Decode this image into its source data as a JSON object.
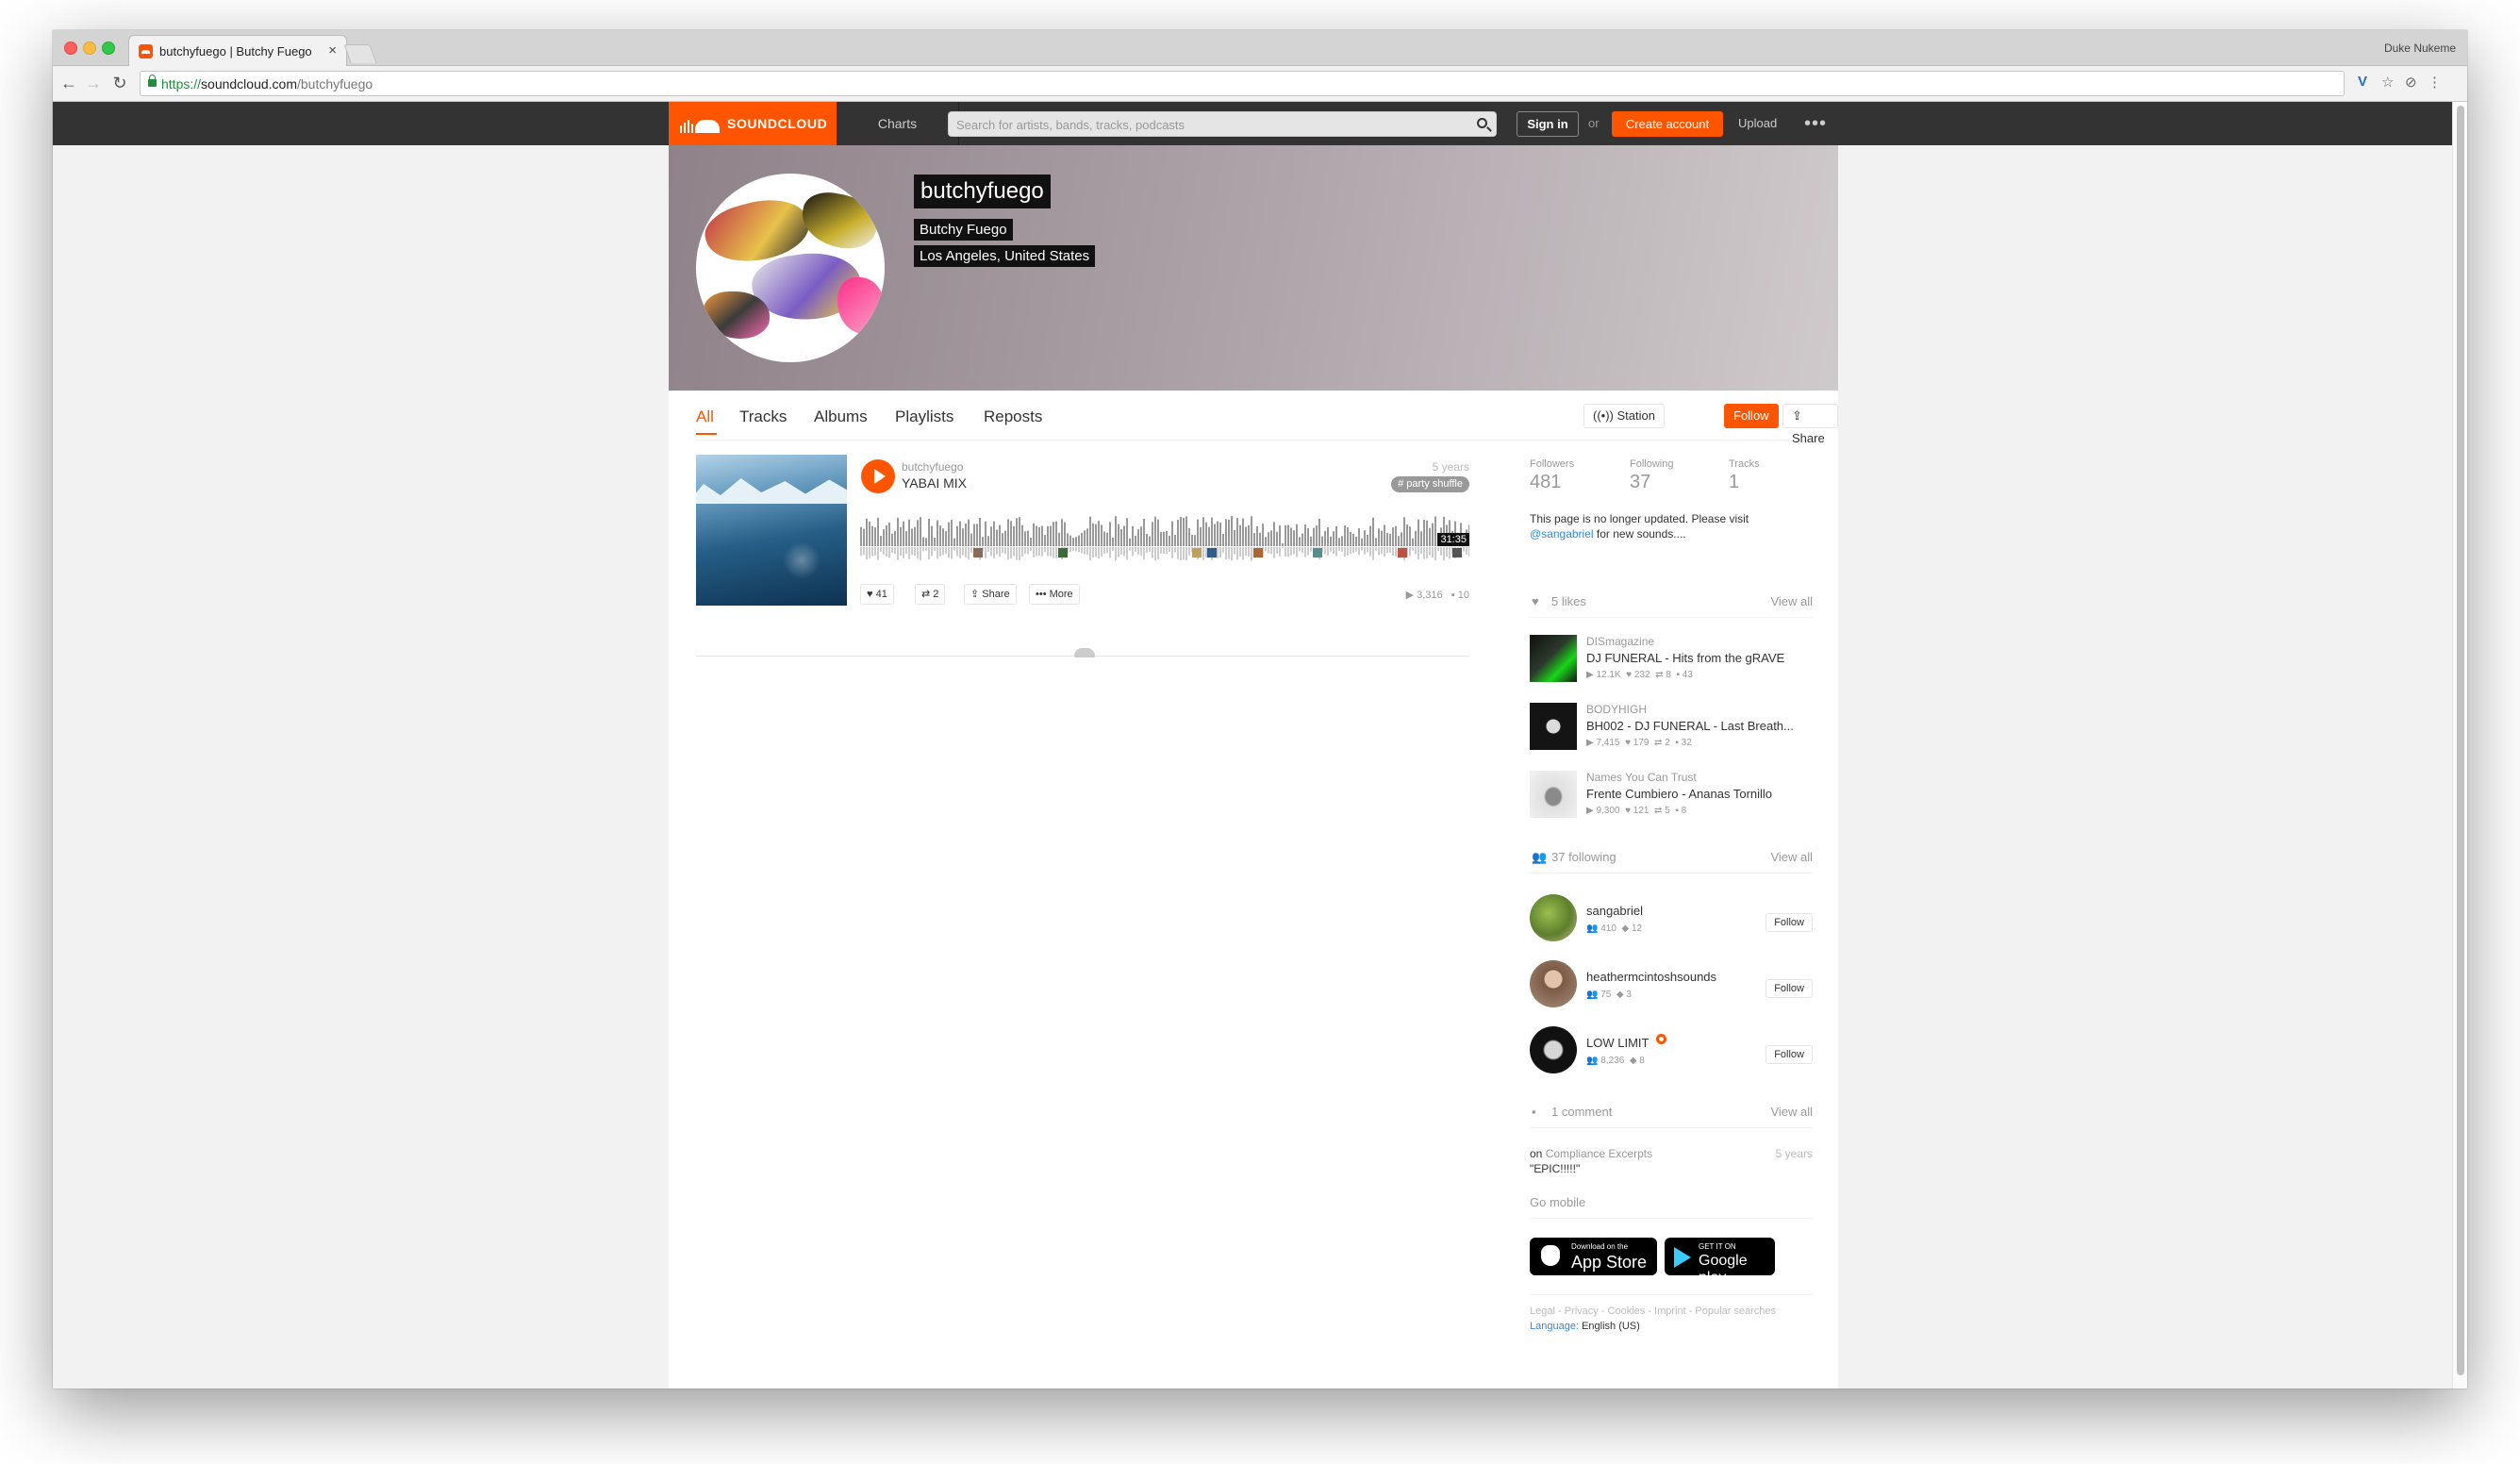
{
  "browser": {
    "tab_title": "butchyfuego | Butchy Fuego",
    "tab_close": "×",
    "url_scheme": "https://",
    "url_host": "soundcloud.com",
    "url_path": "/butchyfuego",
    "profile_name": "Duke Nukeme"
  },
  "header": {
    "logo_text": "SOUNDCLOUD",
    "charts": "Charts",
    "search_placeholder": "Search for artists, bands, tracks, podcasts",
    "sign_in": "Sign in",
    "or": "or",
    "create_account": "Create account",
    "upload": "Upload",
    "more": "•••"
  },
  "profile": {
    "username": "butchyfuego",
    "full_name": "Butchy Fuego",
    "location": "Los Angeles, United States",
    "tabs": [
      "All",
      "Tracks",
      "Albums",
      "Playlists",
      "Reposts"
    ],
    "station": "Station",
    "follow": "Follow",
    "share": "Share"
  },
  "track": {
    "user": "butchyfuego",
    "title": "YABAI MIX",
    "age": "5 years",
    "tag": "# party shuffle",
    "duration": "31:35",
    "likes": "41",
    "reposts": "2",
    "share": "Share",
    "more": "More",
    "plays": "3,316",
    "comments": "10"
  },
  "sidebar": {
    "stats": [
      {
        "label": "Followers",
        "value": "481"
      },
      {
        "label": "Following",
        "value": "37"
      },
      {
        "label": "Tracks",
        "value": "1"
      }
    ],
    "bio_line1": "This page is no longer updated. Please visit",
    "bio_link": "@sangabriel",
    "bio_line2": " for new sounds....",
    "likes_header": "5 likes",
    "view_all": "View all",
    "likes": [
      {
        "user": "DISmagazine",
        "title": "DJ FUNERAL - Hits from the gRAVE",
        "plays": "12.1K",
        "likes": "232",
        "reposts": "8",
        "comments": "43"
      },
      {
        "user": "BODYHIGH",
        "title": "BH002 - DJ FUNERAL - Last Breath...",
        "plays": "7,415",
        "likes": "179",
        "reposts": "2",
        "comments": "32"
      },
      {
        "user": "Names You Can Trust",
        "title": "Frente Cumbiero - Ananas Tornillo",
        "plays": "9,300",
        "likes": "121",
        "reposts": "5",
        "comments": "8"
      }
    ],
    "following_header": "37 following",
    "following": [
      {
        "name": "sangabriel",
        "followers": "410",
        "tracks": "12",
        "button": "Follow"
      },
      {
        "name": "heathermcintoshsounds",
        "followers": "75",
        "tracks": "3",
        "button": "Follow"
      },
      {
        "name": "LOW LIMIT",
        "followers": "8,236",
        "tracks": "8",
        "button": "Follow"
      }
    ],
    "comments_header": "1 comment",
    "comment_on": "on",
    "comment_track": "Compliance Excerpts",
    "comment_age": "5 years",
    "comment_text": "\"EPIC!!!!!\"",
    "go_mobile": "Go mobile",
    "appstore_small": "Download on the",
    "appstore_big": "App Store",
    "gplay_small": "GET IT ON",
    "gplay_big": "Google play",
    "footer_links": "Legal - Privacy - Cookies - Imprint - Popular searches",
    "language_label": "Language:",
    "language_value": " English (US)"
  },
  "colors": {
    "accent": "#ff5500",
    "header_bg": "#333333"
  }
}
